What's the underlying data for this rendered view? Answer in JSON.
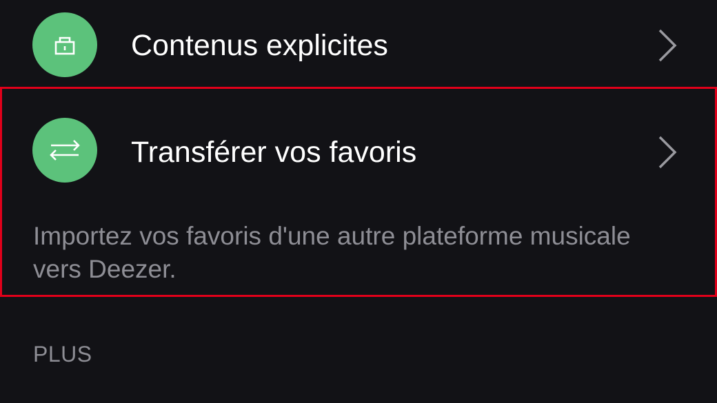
{
  "settings": {
    "explicit_content": {
      "title": "Contenus explicites",
      "icon": "lock-icon",
      "icon_color": "#5cc27b"
    },
    "transfer_favorites": {
      "title": "Transférer vos favoris",
      "description": "Importez vos favoris d'une autre plateforme musicale vers Deezer.",
      "icon": "transfer-arrows-icon",
      "icon_color": "#5cc27b",
      "highlight_color": "#e0001a"
    },
    "section_more": {
      "label": "PLUS"
    }
  },
  "colors": {
    "background": "#121216",
    "text_primary": "#ffffff",
    "text_secondary": "#8e8e95",
    "accent_green": "#5cc27b"
  }
}
